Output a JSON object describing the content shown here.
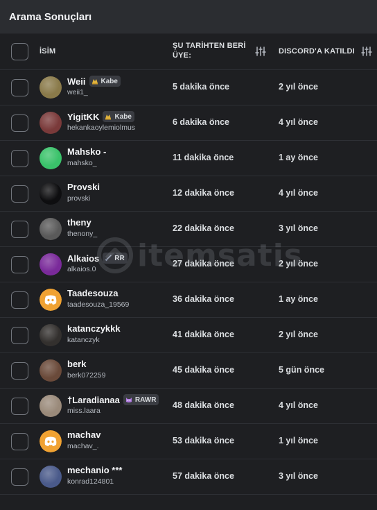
{
  "panel": {
    "title": "Arama Sonuçları"
  },
  "table": {
    "headers": {
      "name": "İSİM",
      "member_since": "ŞU TARİHTEN BERİ ÜYE:",
      "joined": "DISCORD'A KATILDI"
    },
    "rows": [
      {
        "name": "Weii",
        "tag": "Kabe",
        "tag_icon": "guild-tag-icon",
        "handle": "weii1_",
        "member_since": "5 dakika önce",
        "joined": "2 yıl önce",
        "avatar_color": "#8a7a4a"
      },
      {
        "name": "YigitKK",
        "tag": "Kabe",
        "tag_icon": "guild-tag-icon",
        "handle": "hekankaoylemiolmus",
        "member_since": "6 dakika önce",
        "joined": "4 yıl önce",
        "avatar_color": "#7a3a3a"
      },
      {
        "name": "Mahsko -",
        "tag": "",
        "handle": "mahsko_",
        "member_since": "11 dakika önce",
        "joined": "1 ay önce",
        "avatar_color": "#3ac26a"
      },
      {
        "name": "Provski",
        "tag": "",
        "handle": "provski",
        "member_since": "12 dakika önce",
        "joined": "4 yıl önce",
        "avatar_color": "#0e0e10"
      },
      {
        "name": "theny",
        "tag": "",
        "handle": "thenony_",
        "member_since": "22 dakika önce",
        "joined": "3 yıl önce",
        "avatar_color": "#5a5a5a"
      },
      {
        "name": "Alkaios",
        "tag": "RR",
        "tag_icon": "sword-tag-icon",
        "handle": "alkaios.0",
        "member_since": "27 dakika önce",
        "joined": "2 yıl önce",
        "avatar_color": "#7a2a9a"
      },
      {
        "name": "Taadesouza",
        "tag": "",
        "handle": "taadesouza_19569",
        "member_since": "36 dakika önce",
        "joined": "1 ay önce",
        "avatar_color": "#f0a232",
        "default_avatar": true
      },
      {
        "name": "katanczykkk",
        "tag": "",
        "handle": "katanczyk",
        "member_since": "41 dakika önce",
        "joined": "2 yıl önce",
        "avatar_color": "#33302e"
      },
      {
        "name": "berk",
        "tag": "",
        "handle": "berk072259",
        "member_since": "45 dakika önce",
        "joined": "5 gün önce",
        "avatar_color": "#6a4a3a"
      },
      {
        "name": "†Laradianaa",
        "tag": "RAWR",
        "tag_icon": "cat-tag-icon",
        "handle": "miss.laara",
        "member_since": "48 dakika önce",
        "joined": "4 yıl önce",
        "avatar_color": "#9a8a7a"
      },
      {
        "name": "machav",
        "tag": "",
        "handle": "machav_.",
        "member_since": "53 dakika önce",
        "joined": "1 yıl önce",
        "avatar_color": "#f0a232",
        "default_avatar": true
      },
      {
        "name": "mechanio ***",
        "tag": "",
        "handle": "konrad124801",
        "member_since": "57 dakika önce",
        "joined": "3 yıl önce",
        "avatar_color": "#4a5a8a"
      }
    ]
  },
  "watermark": {
    "text": "itemsatis",
    "icon": "itemsatis-logo-icon"
  },
  "colors": {
    "panel_bg": "#2b2d31",
    "table_bg": "#1e1f22",
    "default_avatar": "#f0a232"
  }
}
